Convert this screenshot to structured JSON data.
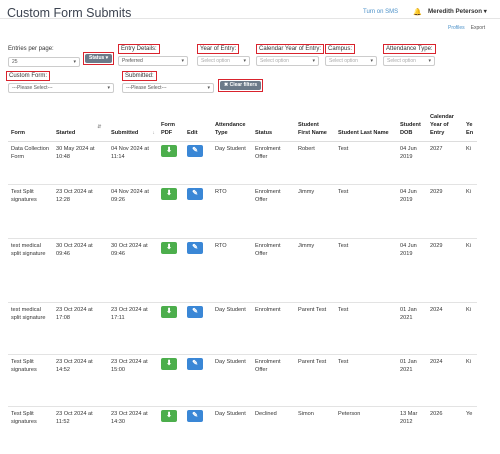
{
  "header": {
    "title": "Custom Form Submits",
    "sms_link": "Turn on SMS",
    "user_name": "Meredith Peterson",
    "nav_profiles": "Profiles",
    "nav_export": "Export"
  },
  "filters": {
    "entries_label": "Entries per page:",
    "entries_value": "25",
    "status_button": "Status",
    "entry_details_label": "Entry Details:",
    "entry_details_value": "Preferred",
    "year_entry_label": "Year of Entry:",
    "year_entry_placeholder": "Select option",
    "cal_year_label": "Calendar Year of Entry:",
    "cal_year_placeholder": "Select option",
    "campus_label": "Campus:",
    "campus_placeholder": "Select option",
    "attendance_label": "Attendance Type:",
    "attendance_placeholder": "Select option",
    "custom_form_label": "Custom Form:",
    "custom_form_value": "---Please Select---",
    "submitted_label": "Submitted:",
    "submitted_value": "---Please Select---",
    "clear_button": "Clear filters"
  },
  "table": {
    "headers": [
      "Form",
      "Started",
      "Submitted",
      "Form PDF",
      "Edit",
      "Attendance Type",
      "Status",
      "Student First Name",
      "Student Last Name",
      "Student DOB",
      "Calendar Year of Entry",
      "Ye En"
    ],
    "rows": [
      {
        "form": "Data Collection Form",
        "started": "30 May 2024 at 10:48",
        "submitted": "04 Nov 2024 at 11:14",
        "attendance": "Day Student",
        "status": "Enrolment Offer",
        "first": "Robert",
        "last": "Test",
        "dob": "04 Jun 2019",
        "cal_year": "2027",
        "ye": "Ki"
      },
      {
        "form": "Test Split signatures",
        "started": "23 Oct 2024 at 12:28",
        "submitted": "04 Nov 2024 at 09:26",
        "attendance": "RTO",
        "status": "Enrolment Offer",
        "first": "Jimmy",
        "last": "Test",
        "dob": "04 Jun 2019",
        "cal_year": "2029",
        "ye": "Ki"
      },
      {
        "form": "test medical split signature",
        "started": "30 Oct 2024 at 09:46",
        "submitted": "30 Oct 2024 at 09:46",
        "attendance": "RTO",
        "status": "Enrolment Offer",
        "first": "Jimmy",
        "last": "Test",
        "dob": "04 Jun 2019",
        "cal_year": "2029",
        "ye": "Ki"
      },
      {
        "form": "test medical split signature",
        "started": "23 Oct 2024 at 17:08",
        "submitted": "23 Oct 2024 at 17:11",
        "attendance": "Day Student",
        "status": "Enrolment",
        "first": "Parent Test",
        "last": "Test",
        "dob": "01 Jan 2021",
        "cal_year": "2024",
        "ye": "Ki"
      },
      {
        "form": "Test Split signatures",
        "started": "23 Oct 2024 at 14:52",
        "submitted": "23 Oct 2024 at 15:00",
        "attendance": "Day Student",
        "status": "Enrolment Offer",
        "first": "Parent Test",
        "last": "Test",
        "dob": "01 Jan 2021",
        "cal_year": "2024",
        "ye": "Ki"
      },
      {
        "form": "Test Split signatures",
        "started": "23 Oct 2024 at 11:52",
        "submitted": "23 Oct 2024 at 14:30",
        "attendance": "Day Student",
        "status": "Declined",
        "first": "Simon",
        "last": "Peterson",
        "dob": "13 Mar 2012",
        "cal_year": "2026",
        "ye": "Ye"
      }
    ]
  }
}
